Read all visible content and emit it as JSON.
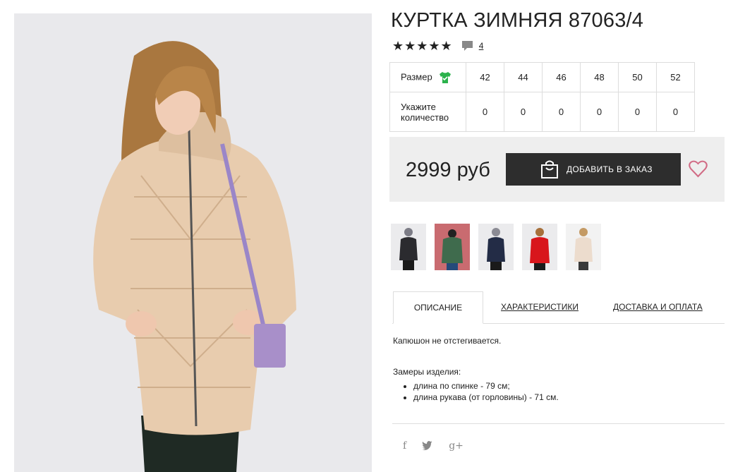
{
  "product": {
    "title": "КУРТКА ЗИМНЯЯ 87063/4",
    "stars": "★★★★★",
    "review_count": "4"
  },
  "sizes": {
    "size_label": "Размер",
    "qty_label": "Укажите количество",
    "values": [
      "42",
      "44",
      "46",
      "48",
      "50",
      "52"
    ],
    "quantities": [
      "0",
      "0",
      "0",
      "0",
      "0",
      "0"
    ]
  },
  "purchase": {
    "price": "2999 руб",
    "add_button": "ДОБАВИТЬ В ЗАКАЗ"
  },
  "thumbnails": [
    {
      "color": "#2b2b2f"
    },
    {
      "color": "#3f6b4d"
    },
    {
      "color": "#232c46"
    },
    {
      "color": "#d8161c"
    },
    {
      "color": "#ecdccd"
    }
  ],
  "tabs": {
    "description": "ОПИСАНИЕ",
    "characteristics": "ХАРАКТЕРИСТИКИ",
    "delivery": "ДОСТАВКА И ОПЛАТА"
  },
  "description": {
    "text": "Капюшон не отстегивается.",
    "measures_title": "Замеры изделия:",
    "measures": [
      "длина по спинке - 79 см;",
      "длина рукава (от горловины) - 71 см."
    ]
  },
  "social": {
    "facebook": "f",
    "twitter": "🐦",
    "google": "g+"
  },
  "colors": {
    "accent": "#2d2d2d",
    "heart": "#d16b85",
    "size_icon": "#2bb24c"
  }
}
